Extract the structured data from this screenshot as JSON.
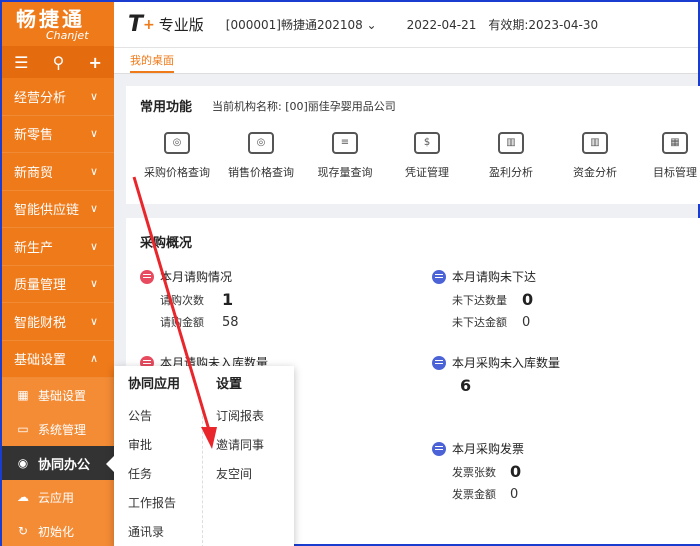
{
  "brand": {
    "cn": "畅捷通",
    "en": "Chanjet"
  },
  "sidebar": {
    "tools": [
      "☰",
      "⚲",
      "+"
    ],
    "items": [
      {
        "label": "经营分析",
        "chev": "∨"
      },
      {
        "label": "新零售",
        "chev": "∨"
      },
      {
        "label": "新商贸",
        "chev": "∨"
      },
      {
        "label": "智能供应链",
        "chev": "∨"
      },
      {
        "label": "新生产",
        "chev": "∨"
      },
      {
        "label": "质量管理",
        "chev": "∨"
      },
      {
        "label": "智能财税",
        "chev": "∨"
      },
      {
        "label": "基础设置",
        "chev": "∧"
      }
    ],
    "sub_items": [
      {
        "label": "基础设置",
        "icon": "▦"
      },
      {
        "label": "系统管理",
        "icon": "▭"
      },
      {
        "label": "协同办公",
        "icon": "◉"
      },
      {
        "label": "云应用",
        "icon": "☁"
      },
      {
        "label": "初始化",
        "icon": "↻"
      }
    ]
  },
  "header": {
    "logo": "T",
    "plus": "+",
    "edition": "专业版",
    "account": "[000001]畅捷通202108 ⌄",
    "date": "2022-04-21",
    "valid": "有效期:2023-04-30"
  },
  "tabs": {
    "home": "我的桌面"
  },
  "common": {
    "title": "常用功能",
    "org": "当前机构名称: [00]丽佳孕婴用品公司",
    "quick": [
      {
        "label": "采购价格查询",
        "icon": "◎"
      },
      {
        "label": "销售价格查询",
        "icon": "◎"
      },
      {
        "label": "现存量查询",
        "icon": "≡"
      },
      {
        "label": "凭证管理",
        "icon": "$"
      },
      {
        "label": "盈利分析",
        "icon": "▥"
      },
      {
        "label": "资金分析",
        "icon": "▥"
      },
      {
        "label": "目标管理",
        "icon": "▦"
      }
    ]
  },
  "purchase": {
    "title": "采购概况",
    "s1": {
      "title": "本月请购情况",
      "k1": "请购次数",
      "v1": "1",
      "k2": "请购金额",
      "v2": "58"
    },
    "s2": {
      "title": "本月请购未下达",
      "k1": "未下达数量",
      "v1": "0",
      "k2": "未下达金额",
      "v2": "0"
    },
    "s3": {
      "title": "本月请购未入库数量"
    },
    "s4": {
      "title": "本月采购未入库数量",
      "v": "6"
    },
    "s5": {
      "title": "本月采购发票",
      "k1": "发票张数",
      "v1": "0",
      "k2": "发票金额",
      "v2": "0"
    }
  },
  "popup": {
    "col1_head": "协同应用",
    "col1": [
      "公告",
      "审批",
      "任务",
      "工作报告",
      "通讯录"
    ],
    "col2_head": "设置",
    "col2": [
      "订阅报表",
      "邀请同事",
      "友空间"
    ]
  },
  "colors": {
    "accent": "#ef7a1a",
    "annotation": "#e8262b"
  }
}
